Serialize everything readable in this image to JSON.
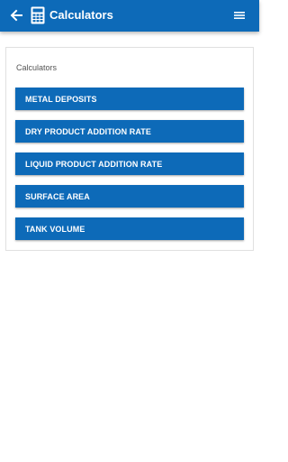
{
  "theme": {
    "brand": "#0d6ab8",
    "on_brand": "#ffffff"
  },
  "header": {
    "title": "Calculators",
    "back_icon": "arrow-left-icon",
    "app_icon": "calculator-icon",
    "menu_icon": "hamburger-menu-icon"
  },
  "card": {
    "heading": "Calculators",
    "items": [
      {
        "label": "METAL DEPOSITS"
      },
      {
        "label": "DRY PRODUCT ADDITION RATE"
      },
      {
        "label": "LIQUID PRODUCT ADDITION RATE"
      },
      {
        "label": "SURFACE AREA"
      },
      {
        "label": "TANK VOLUME"
      }
    ]
  }
}
